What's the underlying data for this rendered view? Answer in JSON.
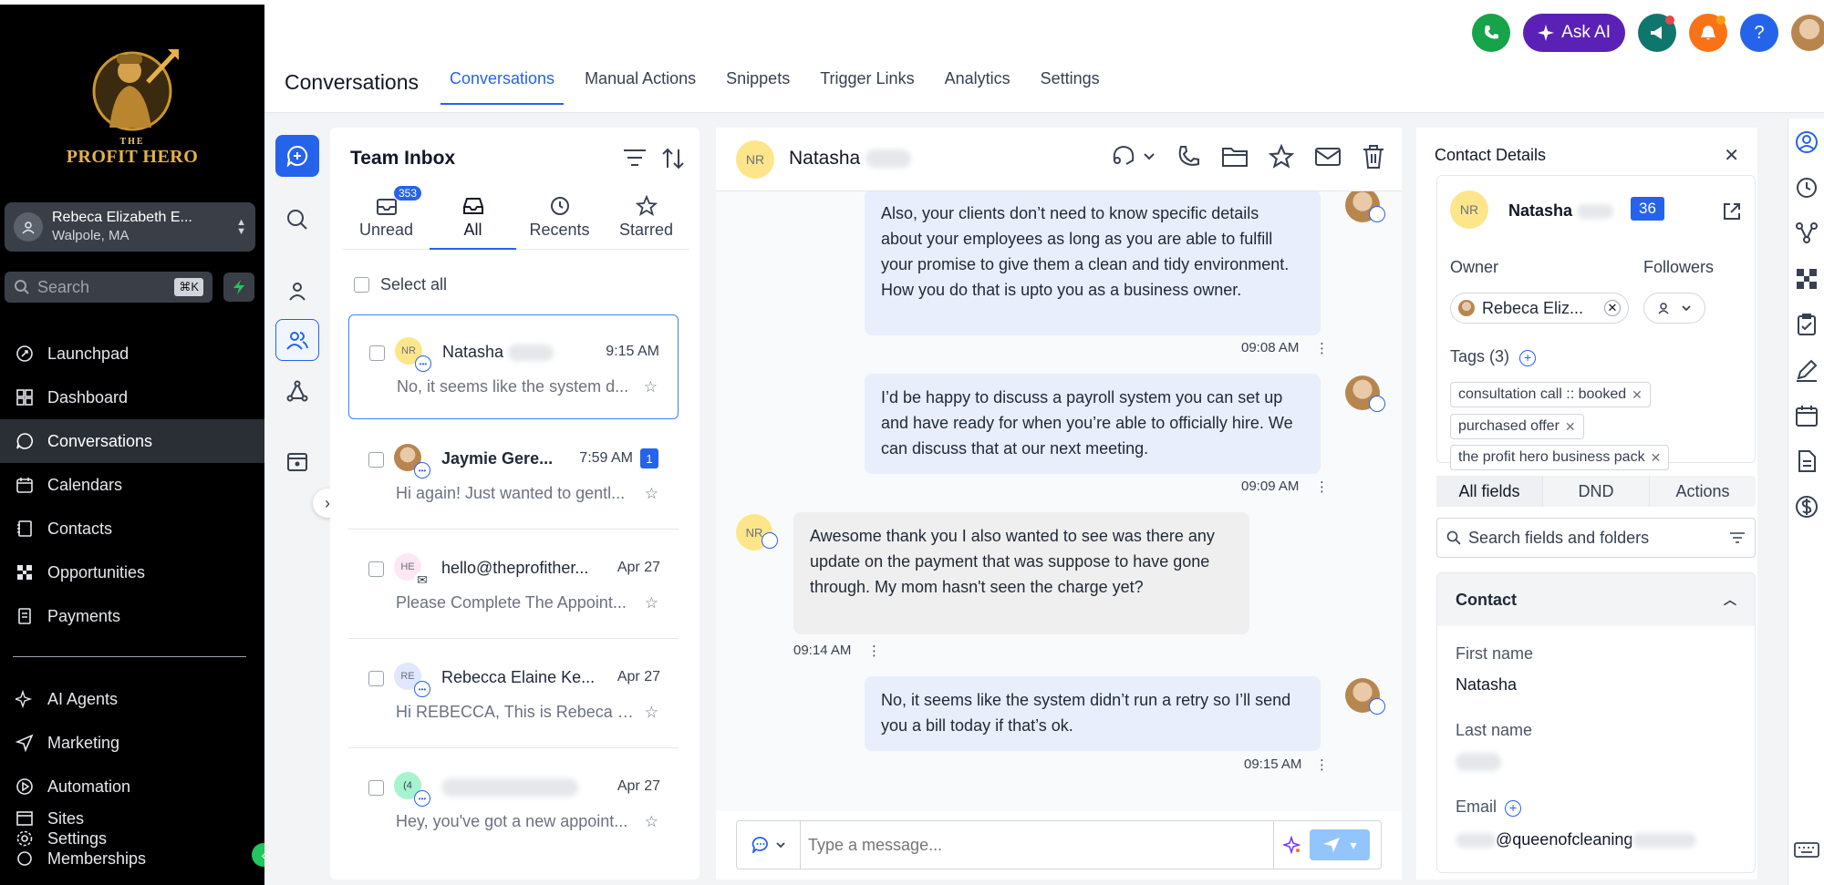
{
  "brand": {
    "line1": "THE",
    "line2": "PROFIT HERO"
  },
  "account": {
    "name": "Rebeca Elizabeth E...",
    "location": "Walpole, MA"
  },
  "sidebar_search": {
    "placeholder": "Search",
    "shortcut": "⌘K"
  },
  "nav_primary": [
    {
      "label": "Launchpad",
      "icon": "rocket-icon"
    },
    {
      "label": "Dashboard",
      "icon": "grid-icon"
    },
    {
      "label": "Conversations",
      "icon": "chat-icon",
      "active": true
    },
    {
      "label": "Calendars",
      "icon": "calendar-icon"
    },
    {
      "label": "Contacts",
      "icon": "contacts-icon"
    },
    {
      "label": "Opportunities",
      "icon": "opportunities-icon"
    },
    {
      "label": "Payments",
      "icon": "payments-icon"
    }
  ],
  "nav_secondary": [
    {
      "label": "AI Agents",
      "icon": "sparkle-icon"
    },
    {
      "label": "Marketing",
      "icon": "send-icon"
    },
    {
      "label": "Automation",
      "icon": "automation-icon"
    },
    {
      "label": "Sites",
      "icon": "sites-icon"
    },
    {
      "label": "Settings",
      "icon": "settings-icon"
    },
    {
      "label": "Memberships",
      "icon": "memberships-icon"
    }
  ],
  "header": {
    "title": "Conversations",
    "tabs": [
      "Conversations",
      "Manual Actions",
      "Snippets",
      "Trigger Links",
      "Analytics",
      "Settings"
    ],
    "active_tab": "Conversations",
    "ask_ai": "Ask AI"
  },
  "inbox": {
    "title": "Team Inbox",
    "tabs": [
      {
        "label": "Unread",
        "badge": "353",
        "icon": "inbox-icon"
      },
      {
        "label": "All",
        "icon": "inbox-tray-icon"
      },
      {
        "label": "Recents",
        "icon": "clock-icon"
      },
      {
        "label": "Starred",
        "icon": "star-icon"
      }
    ],
    "select_all": "Select all",
    "conversations": [
      {
        "initials": "NR",
        "name": "Natasha",
        "time": "9:15 AM",
        "preview": "No, it seems like the system d...",
        "selected": true
      },
      {
        "initials": "",
        "name": "Jaymie Gere...",
        "time": "7:59 AM",
        "preview": "Hi again! Just wanted to gentl...",
        "unread": "1"
      },
      {
        "initials": "HE",
        "name": "hello@theprofither...",
        "time": "Apr 27",
        "preview": "Please Complete The Appoint..."
      },
      {
        "initials": "RE",
        "name": "Rebecca Elaine Ke...",
        "time": "Apr 27",
        "preview": "Hi REBECCA, This is Rebeca El..."
      },
      {
        "initials": "(4",
        "name": "",
        "time": "Apr 27",
        "preview": "Hey, you've got a new appoint..."
      }
    ]
  },
  "chat": {
    "contact_initials": "NR",
    "contact_name": "Natasha",
    "messages": [
      {
        "dir": "out",
        "text": "Also, your clients don’t need to know specific details about your employees as long as you are able to fulfill your promise to give them a clean and tidy environment. How you do that is upto you as a business owner.",
        "time": "09:08 AM"
      },
      {
        "dir": "out",
        "text": "I’d be happy to discuss a payroll system you can set up and have ready for when you’re able to officially hire. We can discuss that at our next meeting.",
        "time": "09:09 AM"
      },
      {
        "dir": "in",
        "initials": "NR",
        "text": "Awesome thank you I also wanted to see was there any update on the payment that was suppose to have gone through. My mom hasn't seen the charge yet?",
        "time": "09:14 AM"
      },
      {
        "dir": "out",
        "text": "No, it seems like the system didn’t run a retry so I’ll send you a bill today if that’s ok.",
        "time": "09:15 AM"
      }
    ],
    "composer_placeholder": "Type a message..."
  },
  "details": {
    "title": "Contact Details",
    "initials": "NR",
    "name": "Natasha",
    "score": "36",
    "owner_label": "Owner",
    "owner": "Rebeca Eliz...",
    "followers_label": "Followers",
    "tags_label": "Tags (3)",
    "tags": [
      "consultation call :: booked",
      "purchased offer",
      "the profit hero business pack"
    ],
    "segments": [
      "All fields",
      "DND",
      "Actions"
    ],
    "search_placeholder": "Search fields and folders",
    "section": "Contact",
    "fields": {
      "first_name_label": "First name",
      "first_name": "Natasha",
      "last_name_label": "Last name",
      "email_label": "Email",
      "email": "@queenofcleaning"
    }
  },
  "colors": {
    "accent": "#2563eb",
    "sidebar_bg": "#000000",
    "ask_ai": "#5b21b6",
    "phone": "#16a34a",
    "bell": "#f97316"
  }
}
